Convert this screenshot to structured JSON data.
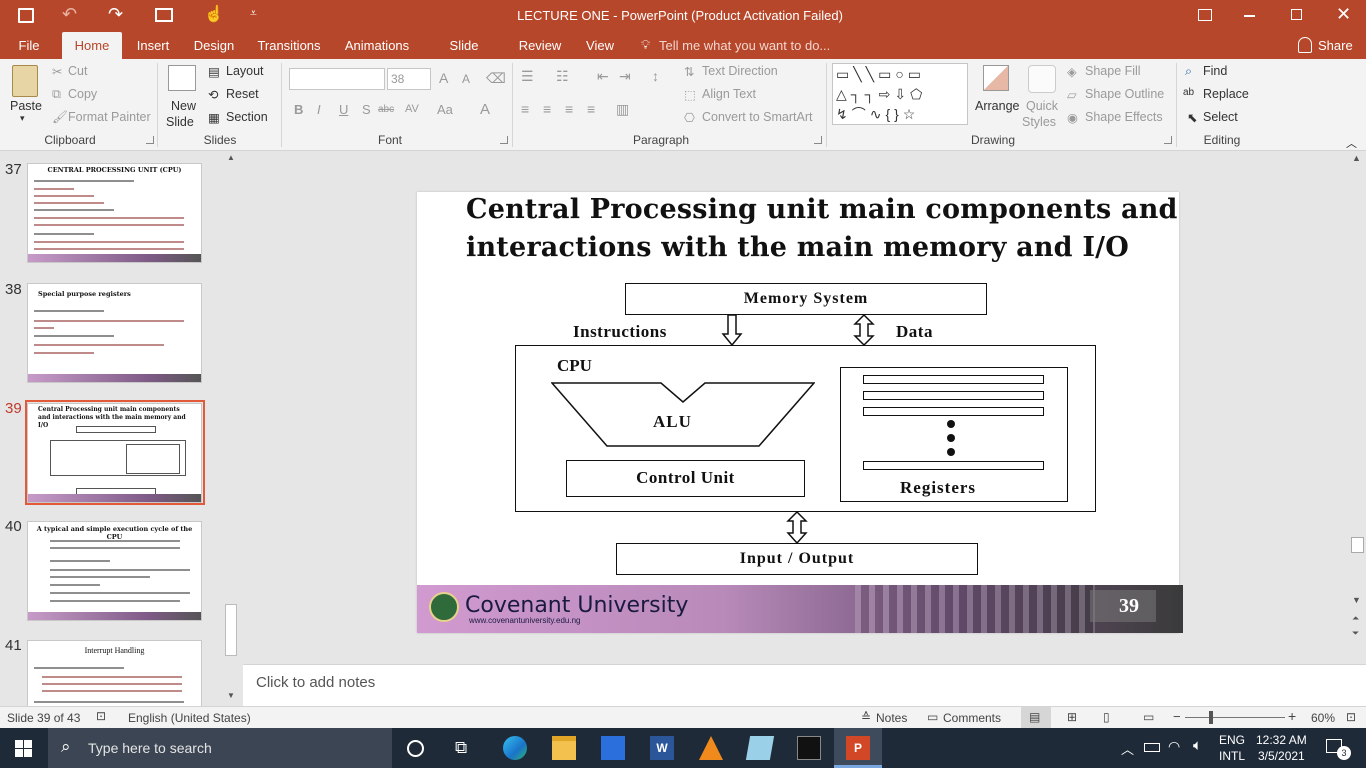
{
  "titlebar": {
    "title": "LECTURE ONE  -  PowerPoint (Product Activation Failed)"
  },
  "tabs": [
    "File",
    "Home",
    "Insert",
    "Design",
    "Transitions",
    "Animations",
    "Slide Show",
    "Review",
    "View"
  ],
  "tellme": "Tell me what you want to do...",
  "share": "Share",
  "ribbon": {
    "clipboard": {
      "paste": "Paste",
      "cut": "Cut",
      "copy": "Copy",
      "format_painter": "Format Painter",
      "label": "Clipboard"
    },
    "slides": {
      "new_slide_1": "New",
      "new_slide_2": "Slide",
      "layout": "Layout",
      "reset": "Reset",
      "section": "Section",
      "label": "Slides"
    },
    "font": {
      "font_size": "38",
      "label": "Font",
      "bold": "B",
      "italic": "I",
      "underline": "U",
      "shadow": "S",
      "strike": "abc",
      "grow": "A",
      "shrink": "A",
      "spacing": "AV",
      "case": "Aa",
      "color": "A"
    },
    "paragraph": {
      "text_direction": "Text Direction",
      "align_text": "Align Text",
      "smartart": "Convert to SmartArt",
      "label": "Paragraph"
    },
    "drawing": {
      "arrange": "Arrange",
      "quick_1": "Quick",
      "quick_2": "Styles",
      "shape_fill": "Shape Fill",
      "shape_outline": "Shape Outline",
      "shape_effects": "Shape Effects",
      "label": "Drawing"
    },
    "editing": {
      "find": "Find",
      "replace": "Replace",
      "select": "Select",
      "label": "Editing"
    }
  },
  "thumbnails": [
    {
      "num": "37",
      "title": "CENTRAL PROCESSING UNIT (CPU)"
    },
    {
      "num": "38",
      "title": "Special purpose registers"
    },
    {
      "num": "39",
      "title": "Central Processing unit main components and interactions with the main memory and I/O"
    },
    {
      "num": "40",
      "title": "A typical and simple execution cycle of the CPU"
    },
    {
      "num": "41",
      "title": "Interrupt Handling"
    }
  ],
  "slide": {
    "title_line1": "Central Processing unit main components and",
    "title_line2": "interactions with the main memory and I/O",
    "memory_system": "Memory System",
    "instructions": "Instructions",
    "data": "Data",
    "cpu": "CPU",
    "alu": "ALU",
    "control_unit": "Control Unit",
    "registers": "Registers",
    "io": "Input / Output",
    "footer_brand": "Covenant University",
    "footer_url": "www.covenantuniversity.edu.ng",
    "page_number": "39"
  },
  "notes_placeholder": "Click to add notes",
  "status": {
    "slide_of": "Slide 39 of 43",
    "language": "English (United States)",
    "notes": "Notes",
    "comments": "Comments",
    "zoom": "60%"
  },
  "taskbar": {
    "search_placeholder": "Type here to search",
    "lang1": "ENG",
    "lang2": "INTL",
    "time": "12:32 AM",
    "date": "3/5/2021",
    "notif_count": "3"
  }
}
